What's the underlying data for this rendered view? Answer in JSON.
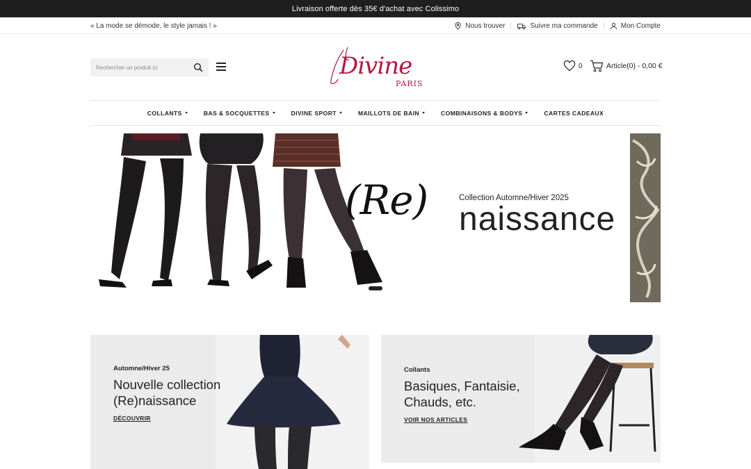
{
  "announcement": "Livraison offerte dès 35€ d'achat avec Colissimo",
  "topbar": {
    "tagline": "« La mode se démode, le style jamais ! »",
    "links": [
      {
        "label": "Nous trouver",
        "icon": "map-pin-icon"
      },
      {
        "label": "Suivre ma commande",
        "icon": "truck-icon"
      },
      {
        "label": "Mon Compte",
        "icon": "user-icon"
      }
    ]
  },
  "header": {
    "search_placeholder": "Rechercher un produit ici",
    "logo_text": "Divine",
    "logo_sub": "PARIS",
    "wishlist_count": "0",
    "cart_label": "Article(0) - 0,00 €"
  },
  "nav": [
    {
      "label": "COLLANTS",
      "dropdown": true
    },
    {
      "label": "BAS & SOCQUETTES",
      "dropdown": true
    },
    {
      "label": "DIVINE SPORT",
      "dropdown": true
    },
    {
      "label": "MAILLOTS DE BAIN",
      "dropdown": true
    },
    {
      "label": "COMBINAISONS & BODYS",
      "dropdown": true
    },
    {
      "label": "CARTES CADEAUX",
      "dropdown": false
    }
  ],
  "hero": {
    "collection": "Collection Automne/Hiver 2025",
    "re": "(Re)",
    "naissance": "naissance"
  },
  "cards": [
    {
      "kicker": "Automne/Hiver 25",
      "title_line1": "Nouvelle collection",
      "title_line2": "(Re)naissance",
      "link": "DÉCOUVRIR"
    },
    {
      "kicker": "Collants",
      "title_line1": "Basiques, Fantaisie,",
      "title_line2": "Chauds, etc.",
      "link": "VOIR NOS ARTICLES"
    }
  ],
  "colors": {
    "brand": "#b5173f",
    "announce_bg": "#1f1f1f",
    "card_bg": "#ebebeb"
  }
}
